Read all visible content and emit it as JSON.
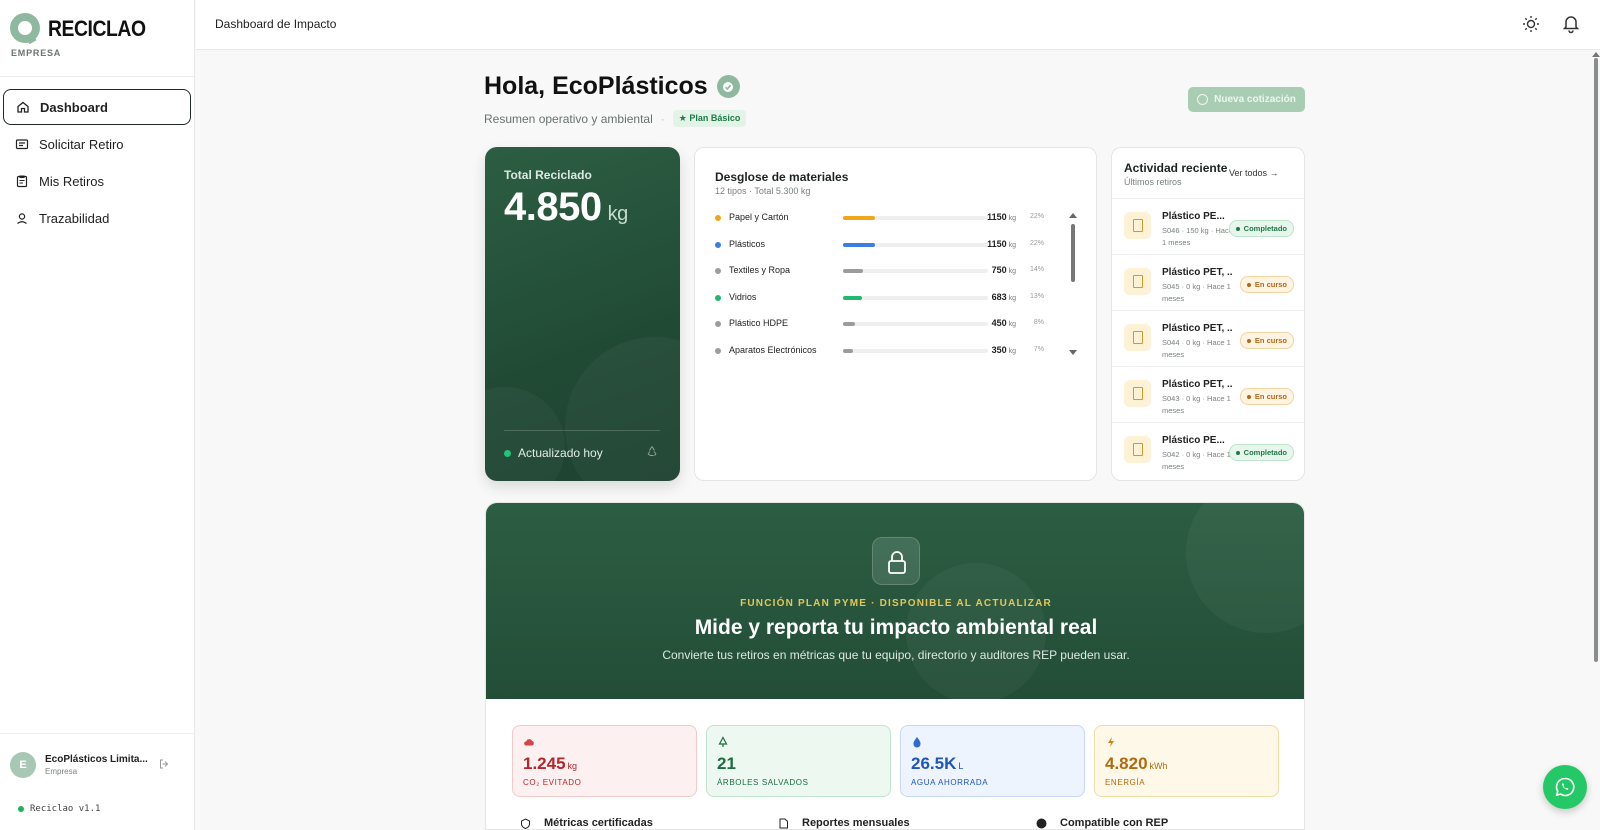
{
  "brand": {
    "name": "RECICLAO",
    "sub": "EMPRESA"
  },
  "nav": [
    {
      "label": "Dashboard",
      "icon": "home-icon",
      "active": true
    },
    {
      "label": "Solicitar Retiro",
      "icon": "request-icon"
    },
    {
      "label": "Mis Retiros",
      "icon": "clipboard-icon"
    },
    {
      "label": "Trazabilidad",
      "icon": "location-icon"
    }
  ],
  "user": {
    "initial": "E",
    "name": "EcoPlásticos Limita...",
    "role": "Empresa",
    "version": "Reciclao v1.1"
  },
  "topbar": {
    "title": "Dashboard de Impacto"
  },
  "header": {
    "greeting": "Hola, EcoPlásticos",
    "subtitle": "Resumen operativo y ambiental",
    "separator": "·",
    "plan": "★ Plan Básico",
    "quote_button": "Nueva cotización"
  },
  "total": {
    "label": "Total Reciclado",
    "value": "4.850",
    "unit": "kg",
    "status": "Actualizado hoy"
  },
  "materials": {
    "title": "Desglose de materiales",
    "subtitle": "12 tipos · Total 5.300 kg",
    "items": [
      {
        "name": "Papel y Cartón",
        "value": "1150",
        "unit": "kg",
        "pct": "22%",
        "share": 0.22,
        "color": "#f0a61c"
      },
      {
        "name": "Plásticos",
        "value": "1150",
        "unit": "kg",
        "pct": "22%",
        "share": 0.22,
        "color": "#3d7de0"
      },
      {
        "name": "Textiles y Ropa",
        "value": "750",
        "unit": "kg",
        "pct": "14%",
        "share": 0.14,
        "color": "#9a9d9b"
      },
      {
        "name": "Vidrios",
        "value": "683",
        "unit": "kg",
        "pct": "13%",
        "share": 0.13,
        "color": "#22b870"
      },
      {
        "name": "Plástico HDPE",
        "value": "450",
        "unit": "kg",
        "pct": "8%",
        "share": 0.08,
        "color": "#9a9d9b"
      },
      {
        "name": "Aparatos Electrónicos",
        "value": "350",
        "unit": "kg",
        "pct": "7%",
        "share": 0.07,
        "color": "#9a9d9b"
      }
    ]
  },
  "activity": {
    "title": "Actividad reciente",
    "subtitle": "Últimos retiros",
    "view_all": "Ver todos →",
    "items": [
      {
        "name": "Plástico PE...",
        "meta": "S046 · 150 kg · Hace 1 meses",
        "status": "Completado",
        "kind": "done"
      },
      {
        "name": "Plástico PET, ...",
        "meta": "S045 · 0 kg · Hace 1 meses",
        "status": "En curso",
        "kind": "prog"
      },
      {
        "name": "Plástico PET, ...",
        "meta": "S044 · 0 kg · Hace 1 meses",
        "status": "En curso",
        "kind": "prog"
      },
      {
        "name": "Plástico PET, ...",
        "meta": "S043 · 0 kg · Hace 1 meses",
        "status": "En curso",
        "kind": "prog"
      },
      {
        "name": "Plástico PE...",
        "meta": "S042 · 0 kg · Hace 1 meses",
        "status": "Completado",
        "kind": "done"
      }
    ]
  },
  "upsell": {
    "kicker": "FUNCIÓN PLAN PYME · DISPONIBLE AL ACTUALIZAR",
    "headline": "Mide y reporta tu impacto ambiental real",
    "description": "Convierte tus retiros en métricas que tu equipo, directorio y auditores REP pueden usar.",
    "metrics": [
      {
        "value": "1.245",
        "unit": "kg",
        "label": "CO₂ EVITADO"
      },
      {
        "value": "21",
        "unit": "",
        "label": "ÁRBOLES SALVADOS"
      },
      {
        "value": "26.5K",
        "unit": "L",
        "label": "AGUA AHORRADA"
      },
      {
        "value": "4.820",
        "unit": "kWh",
        "label": "ENERGÍA"
      }
    ],
    "features": [
      "Métricas certificadas",
      "Reportes mensuales",
      "Compatible con REP"
    ]
  }
}
